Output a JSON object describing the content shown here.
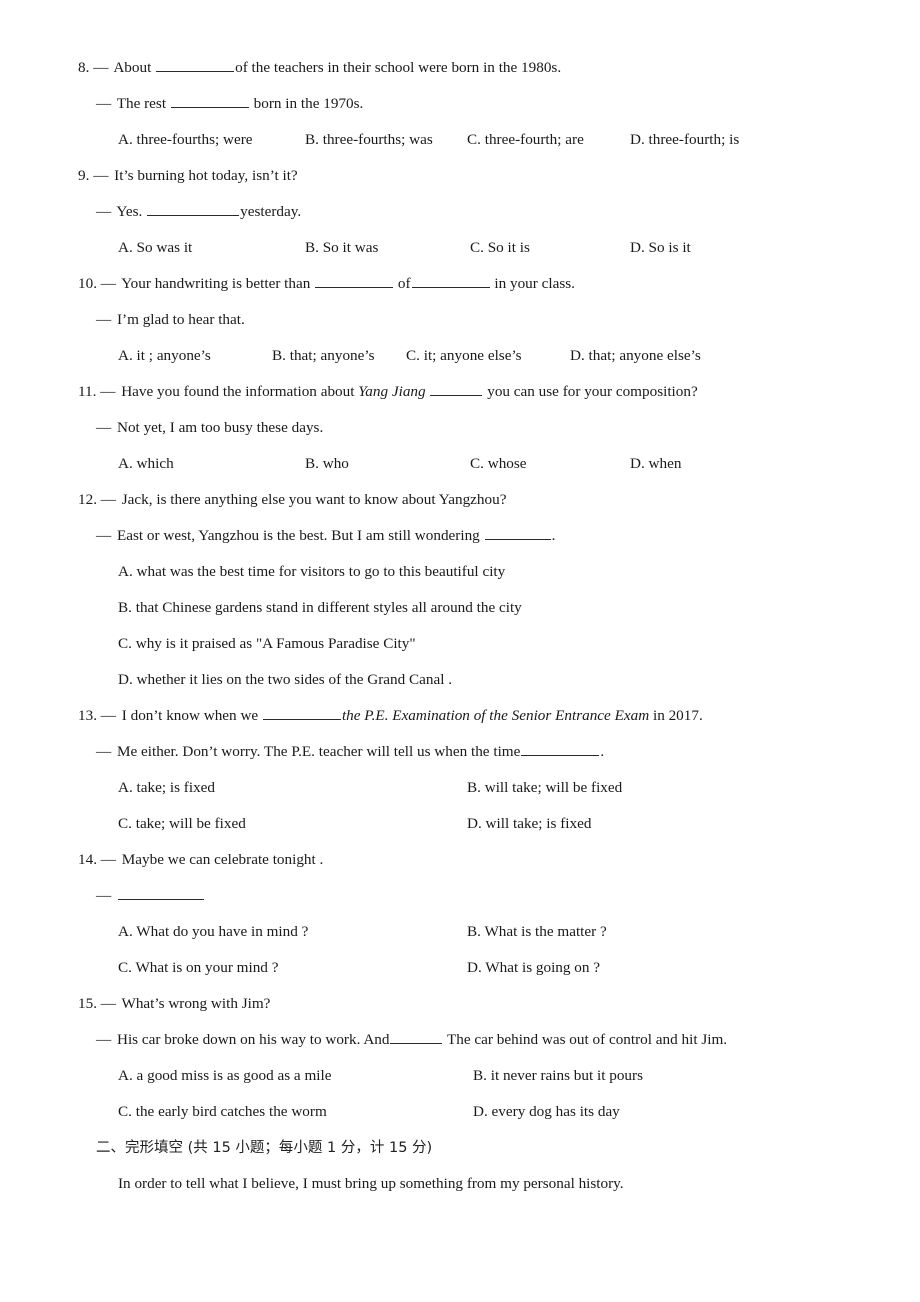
{
  "page": {
    "dash": "—"
  },
  "questions": [
    {
      "number": "8.",
      "stem_pre": "About",
      "stem_post": "of the teachers in their school were born in the 1980s.",
      "reply_pre": "The rest",
      "reply_post": "born in the 1970s.",
      "options": [
        "A. three-fourths; were",
        "B. three-fourths; was",
        "C. three-fourth; are",
        "D. three-fourth; is"
      ]
    },
    {
      "number": "9.",
      "stem": "It’s burning hot today, isn’t it?",
      "reply_pre": "Yes.",
      "reply_post": "yesterday.",
      "options": [
        "A. So was it",
        "B. So it was",
        "C. So it is",
        "D. So is it"
      ]
    },
    {
      "number": "10.",
      "stem_pre": "Your handwriting is better than",
      "stem_mid": "of",
      "stem_post": "in your class.",
      "reply": "I’m glad to hear that.",
      "options": [
        "A. it ; anyone’s",
        "B. that; anyone’s",
        "C. it; anyone else’s",
        "D. that; anyone else’s"
      ]
    },
    {
      "number": "11.",
      "stem_pre": "Have you found the information about",
      "stem_italic": "Yang Jiang",
      "stem_post": "you can use for your composition?",
      "reply": "Not yet, I am too busy these days.",
      "options": [
        "A. which",
        "B. who",
        "C. whose",
        "D. when"
      ]
    },
    {
      "number": "12.",
      "stem": "Jack, is there anything else you want to know about Yangzhou?",
      "reply_pre": "East or west, Yangzhou is the best. But I am still wondering",
      "reply_post": ".",
      "options": [
        "A. what was the best time for visitors to go to this beautiful city",
        "B. that Chinese gardens stand in different styles all around the city",
        "C. why is it praised as \"A Famous Paradise City\"",
        "D. whether it lies on the two sides of the Grand Canal ."
      ]
    },
    {
      "number": "13.",
      "stem_pre": "I don’t know when we",
      "stem_italic": "the P.E. Examination of the Senior Entrance Exam",
      "stem_post": "in 2017.",
      "reply_pre": "Me either. Don’t worry. The P.E. teacher will tell us when the time",
      "reply_post": ".",
      "options": [
        "A. take; is fixed",
        "B. will take; will be fixed",
        "C. take; will be fixed",
        "D. will take; is fixed"
      ]
    },
    {
      "number": "14.",
      "stem": "Maybe we can celebrate tonight .",
      "options": [
        "A. What do you have in mind ?",
        "B. What is the matter ?",
        "C. What is on your mind ?",
        "D. What is going on ?"
      ]
    },
    {
      "number": "15.",
      "stem": "What’s wrong with Jim?",
      "reply_pre": "His car broke down on his way to work. And",
      "reply_post": "The car behind was out of control and hit Jim.",
      "options": [
        "A. a good miss is as good as a mile",
        "B. it never rains but it pours",
        "C. the early bird catches the worm",
        "D. every dog has its day"
      ]
    }
  ],
  "section": {
    "heading": "二、完形填空 (共 15 小题；每小题 1 分，计 15 分)",
    "passage_first_line": "In order to tell what I believe, I must bring up something from my personal history."
  }
}
